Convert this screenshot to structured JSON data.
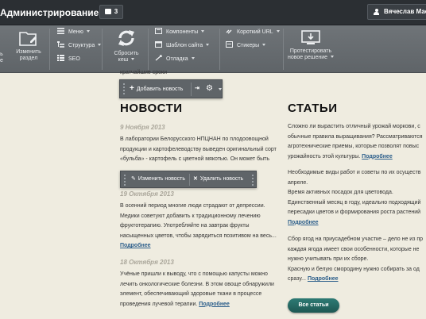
{
  "topbar": {
    "title": "Администрирование",
    "notifications_count": "3",
    "user_name": "Вячеслав Мас"
  },
  "toolbar": {
    "left_cut_label_1": "ь",
    "left_cut_label_2": "е",
    "change_section_label_1": "Изменить",
    "change_section_label_2": "раздел",
    "menu_label": "Меню",
    "structure_label": "Структура",
    "seo_label": "SEO",
    "reset_cache_label_1": "Сбросить",
    "reset_cache_label_2": "кеш",
    "components_label": "Компоненты",
    "site_template_label": "Шаблон сайта",
    "debug_label": "Отладка",
    "short_url_label": "Короткий URL",
    "stickers_label": "Стикеры",
    "test_label_1": "Протестировать",
    "test_label_2": "новое решение"
  },
  "add_news_panel": {
    "cut_text": "кратчайшие сроки",
    "add_label": "Добавить новость"
  },
  "news": {
    "heading": "НОВОСТИ",
    "items": [
      {
        "date": "9 Ноября 2013",
        "lines": [
          "В лаборатории Белорусского НПЦНАН по плодоовощной",
          "продукции и картофелеводству выведен оригинальный сорт",
          "«бульба» - картофель с цветной мякотью. Он может быть"
        ]
      },
      {
        "date": "19 Октября 2013",
        "lines": [
          "В осенний период многие люди страдают от депрессии.",
          "Медики советуют добавить к традиционному лечению",
          "фруктотерапию. Употребляйте на завтрак фрукты",
          "насыщенных цветов, чтобы зарядиться позитивом на весь..."
        ],
        "more": "Подробнее"
      },
      {
        "date": "18 Октября 2013",
        "lines": [
          "Учёные пришли к выводу, что с помощью капусты можно",
          "лечить онкологические болезни. В этом овоще обнаружили",
          "элемент, обеспечивающий здоровые ткани в процессе"
        ],
        "last_line": "проведения лучевой терапии.",
        "more": "Подробнее"
      }
    ]
  },
  "edit_panel": {
    "edit_label": "Изменить новость",
    "delete_label": "Удалить новость"
  },
  "articles": {
    "heading": "СТАТЬИ",
    "block1": [
      "Сложно ли вырастить отличный урожай моркови, с",
      "обычные правила выращивания? Рассматриваются",
      "агротехнические приемы, которые позволят повыс"
    ],
    "block1_last": "урожайность этой культуры.",
    "block2": [
      "Необходимые виды работ и советы по их осуществ",
      "апреле.",
      "Время активных посадок для цветовода.",
      "Единственный месяц в году, идеально подходящий",
      "пересадки цветов и формирования роста растений"
    ],
    "block3": [
      "Сбор ягод на приусадебном участке – дело не из пр",
      "каждая ягода имеет свои особенности, которые не",
      "нужно учитывать при их сборе.",
      "Красную и белую смородину нужно собирать за од"
    ],
    "block3_last": "сразу...",
    "more": "Подробнее",
    "all_button": "Все статьи"
  },
  "colors": {
    "topbar": "#2b2f33",
    "toolbar": "#6a6f73",
    "page_bg": "#efece0",
    "link": "#2a5d8a",
    "accent_button": "#25675f"
  }
}
